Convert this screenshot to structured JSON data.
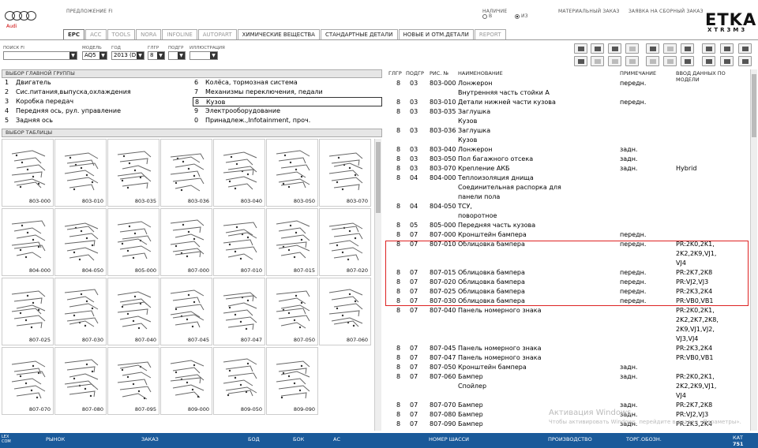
{
  "header": {
    "brand": "Audi",
    "offer_label": "ПРЕДЛОЖЕНИЕ FI",
    "availability_label": "НАЛИЧИЕ",
    "radio_in": "В",
    "radio_from": "ИЗ",
    "order_label": "МАТЕРИАЛЬНЫЙ ЗАКАЗ",
    "collective_order_label": "ЗАЯВКА НА СБОРНЫЙ ЗАКАЗ",
    "logo": "ETKA",
    "logo_sub": "XTR3M3"
  },
  "tabs": [
    "EPC",
    "ACC",
    "TOOLS",
    "NORA",
    "INFOLINE",
    "AUTOPART",
    "ХИМИЧЕСКИЕ ВЕЩЕСТВА",
    "СТАНДАРТНЫЕ ДЕТАЛИ",
    "НОВЫЕ И ОТМ.ДЕТАЛИ",
    "REPORT"
  ],
  "filters": {
    "search_label": "ПОИСК FI",
    "model_label": "МОДЕЛЬ",
    "model_value": "AQ5",
    "year_label": "ГОД",
    "year_value": "2013 (D)",
    "group_label": "ГЛГР",
    "group_value": "8",
    "subgroup_label": "ПОДГР",
    "illustration_label": "ИЛЛЮСТРАЦИЯ"
  },
  "main_groups": {
    "title": "ВЫБОР ГЛАВНОЙ ГРУППЫ",
    "left": [
      {
        "num": "1",
        "name": "Двигатель"
      },
      {
        "num": "2",
        "name": "Сис.питания,выпуска,охлаждения"
      },
      {
        "num": "3",
        "name": "Коробка передач"
      },
      {
        "num": "4",
        "name": "Передняя ось, рул. управление"
      },
      {
        "num": "5",
        "name": "Задняя ось"
      }
    ],
    "right": [
      {
        "num": "6",
        "name": "Колёса, тормозная система"
      },
      {
        "num": "7",
        "name": "Механизмы переключения, педали"
      },
      {
        "num": "8",
        "name": "Кузов"
      },
      {
        "num": "9",
        "name": "Электрооборудование"
      },
      {
        "num": "0",
        "name": "Принадлеж.,Infotainment, проч."
      }
    ]
  },
  "tables_title": "ВЫБОР ТАБЛИЦЫ",
  "thumbnails": [
    "803-000",
    "803-010",
    "803-035",
    "803-036",
    "803-040",
    "803-050",
    "803-070",
    "804-000",
    "804-050",
    "805-000",
    "807-000",
    "807-010",
    "807-015",
    "807-020",
    "807-025",
    "807-030",
    "807-040",
    "807-045",
    "807-047",
    "807-050",
    "807-060",
    "807-070",
    "807-080",
    "807-095",
    "809-000",
    "809-050",
    "809-090"
  ],
  "parts_table": {
    "headers": [
      "ГЛГР",
      "ПОДГР",
      "РИС. №",
      "НАИМЕНОВАНИЕ",
      "ПРИМЕЧАНИЕ",
      "ВВОД ДАННЫХ ПО МОДЕЛИ"
    ],
    "rows": [
      {
        "g": "8",
        "sg": "03",
        "fig": "803-000",
        "name": "Лонжерон",
        "note": "передн.",
        "model": ""
      },
      {
        "g": "",
        "sg": "",
        "fig": "",
        "name": "Внутренняя часть стойки А",
        "note": "",
        "model": ""
      },
      {
        "g": "8",
        "sg": "03",
        "fig": "803-010",
        "name": "Детали нижней части кузова",
        "note": "передн.",
        "model": ""
      },
      {
        "g": "8",
        "sg": "03",
        "fig": "803-035",
        "name": "Заглушка",
        "note": "",
        "model": ""
      },
      {
        "g": "",
        "sg": "",
        "fig": "",
        "name": "Кузов",
        "note": "",
        "model": ""
      },
      {
        "g": "8",
        "sg": "03",
        "fig": "803-036",
        "name": "Заглушка",
        "note": "",
        "model": ""
      },
      {
        "g": "",
        "sg": "",
        "fig": "",
        "name": "Кузов",
        "note": "",
        "model": ""
      },
      {
        "g": "8",
        "sg": "03",
        "fig": "803-040",
        "name": "Лонжерон",
        "note": "задн.",
        "model": ""
      },
      {
        "g": "8",
        "sg": "03",
        "fig": "803-050",
        "name": "Пол багажного отсека",
        "note": "задн.",
        "model": ""
      },
      {
        "g": "8",
        "sg": "03",
        "fig": "803-070",
        "name": "Крепление АКБ",
        "note": "задн.",
        "model": "Hybrid"
      },
      {
        "g": "8",
        "sg": "04",
        "fig": "804-000",
        "name": "Теплоизоляция днища",
        "note": "",
        "model": ""
      },
      {
        "g": "",
        "sg": "",
        "fig": "",
        "name": "Соединительная распорка для",
        "note": "",
        "model": ""
      },
      {
        "g": "",
        "sg": "",
        "fig": "",
        "name": "панели пола",
        "note": "",
        "model": ""
      },
      {
        "g": "8",
        "sg": "04",
        "fig": "804-050",
        "name": "ТСУ,",
        "note": "",
        "model": ""
      },
      {
        "g": "",
        "sg": "",
        "fig": "",
        "name": "поворотное",
        "note": "",
        "model": ""
      },
      {
        "g": "8",
        "sg": "05",
        "fig": "805-000",
        "name": "Передняя часть кузова",
        "note": "",
        "model": ""
      },
      {
        "g": "8",
        "sg": "07",
        "fig": "807-000",
        "name": "Кронштейн бампера",
        "note": "передн.",
        "model": ""
      },
      {
        "g": "8",
        "sg": "07",
        "fig": "807-010",
        "name": "Облицовка бампера",
        "note": "передн.",
        "model": "PR:2K0,2K1,"
      },
      {
        "g": "",
        "sg": "",
        "fig": "",
        "name": "",
        "note": "",
        "model": "2K2,2K9,VJ1,"
      },
      {
        "g": "",
        "sg": "",
        "fig": "",
        "name": "",
        "note": "",
        "model": "VJ4"
      },
      {
        "g": "8",
        "sg": "07",
        "fig": "807-015",
        "name": "Облицовка бампера",
        "note": "передн.",
        "model": "PR:2K7,2K8"
      },
      {
        "g": "8",
        "sg": "07",
        "fig": "807-020",
        "name": "Облицовка бампера",
        "note": "передн.",
        "model": "PR:VJ2,VJ3"
      },
      {
        "g": "8",
        "sg": "07",
        "fig": "807-025",
        "name": "Облицовка бампера",
        "note": "передн.",
        "model": "PR:2K3,2K4"
      },
      {
        "g": "8",
        "sg": "07",
        "fig": "807-030",
        "name": "Облицовка бампера",
        "note": "передн.",
        "model": "PR:VB0,VB1"
      },
      {
        "g": "8",
        "sg": "07",
        "fig": "807-040",
        "name": "Панель номерного знака",
        "note": "",
        "model": "PR:2K0,2K1,"
      },
      {
        "g": "",
        "sg": "",
        "fig": "",
        "name": "",
        "note": "",
        "model": "2K2,2K7,2K8,"
      },
      {
        "g": "",
        "sg": "",
        "fig": "",
        "name": "",
        "note": "",
        "model": "2K9,VJ1,VJ2,"
      },
      {
        "g": "",
        "sg": "",
        "fig": "",
        "name": "",
        "note": "",
        "model": "VJ3,VJ4"
      },
      {
        "g": "8",
        "sg": "07",
        "fig": "807-045",
        "name": "Панель номерного знака",
        "note": "",
        "model": "PR:2K3,2K4"
      },
      {
        "g": "8",
        "sg": "07",
        "fig": "807-047",
        "name": "Панель номерного знака",
        "note": "",
        "model": "PR:VB0,VB1"
      },
      {
        "g": "8",
        "sg": "07",
        "fig": "807-050",
        "name": "Кронштейн бампера",
        "note": "задн.",
        "model": ""
      },
      {
        "g": "8",
        "sg": "07",
        "fig": "807-060",
        "name": "Бампер",
        "note": "задн.",
        "model": "PR:2K0,2K1,"
      },
      {
        "g": "",
        "sg": "",
        "fig": "",
        "name": "Спойлер",
        "note": "",
        "model": "2K2,2K9,VJ1,"
      },
      {
        "g": "",
        "sg": "",
        "fig": "",
        "name": "",
        "note": "",
        "model": "VJ4"
      },
      {
        "g": "8",
        "sg": "07",
        "fig": "807-070",
        "name": "Бампер",
        "note": "задн.",
        "model": "PR:2K7,2K8"
      },
      {
        "g": "8",
        "sg": "07",
        "fig": "807-080",
        "name": "Бампер",
        "note": "задн.",
        "model": "PR:VJ2,VJ3"
      },
      {
        "g": "8",
        "sg": "07",
        "fig": "807-090",
        "name": "Бампер",
        "note": "задн.",
        "model": "PR:2K3,2K4"
      }
    ]
  },
  "watermark": "Активация Windows",
  "watermark_sub": "Чтобы активировать Windows, перейдите в раздел «Параметры».",
  "status_bar": {
    "left_icon": "LEX COM",
    "items": [
      "РЫНОК",
      "ЗАКАЗ",
      "БОД",
      "БОК",
      "АС",
      "НОМЕР ШАССИ",
      "ПРОИЗВОДСТВО",
      "ТОРГ.ОБОЗН."
    ],
    "cat_label": "КАТ",
    "cat_value": "751"
  }
}
